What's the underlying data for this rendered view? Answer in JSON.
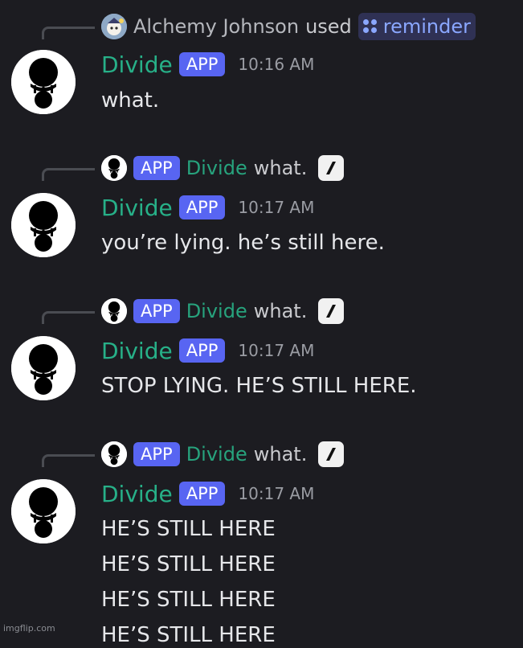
{
  "messages": [
    {
      "reply": {
        "kind": "command",
        "user": "Alchemy Johnson",
        "used_text": "used",
        "command": "reminder"
      },
      "author": "Divide",
      "badge": "APP",
      "time": "10:16 AM",
      "lines": [
        "what."
      ]
    },
    {
      "reply": {
        "kind": "message",
        "badge": "APP",
        "author": "Divide",
        "text": "what."
      },
      "author": "Divide",
      "badge": "APP",
      "time": "10:17 AM",
      "lines": [
        "you’re lying. he’s still here."
      ]
    },
    {
      "reply": {
        "kind": "message",
        "badge": "APP",
        "author": "Divide",
        "text": "what."
      },
      "author": "Divide",
      "badge": "APP",
      "time": "10:17 AM",
      "lines": [
        "STOP LYING. HE’S STILL HERE."
      ]
    },
    {
      "reply": {
        "kind": "message",
        "badge": "APP",
        "author": "Divide",
        "text": "what."
      },
      "author": "Divide",
      "badge": "APP",
      "time": "10:17 AM",
      "lines": [
        "HE’S STILL HERE",
        "HE’S STILL HERE",
        "HE’S STILL HERE",
        "HE’S STILL HERE"
      ]
    }
  ],
  "watermark": "imgflip.com",
  "colors": {
    "background": "#1c1c21",
    "author": "#27b088",
    "app_badge": "#5865f2",
    "command": "#8aa7ff"
  }
}
